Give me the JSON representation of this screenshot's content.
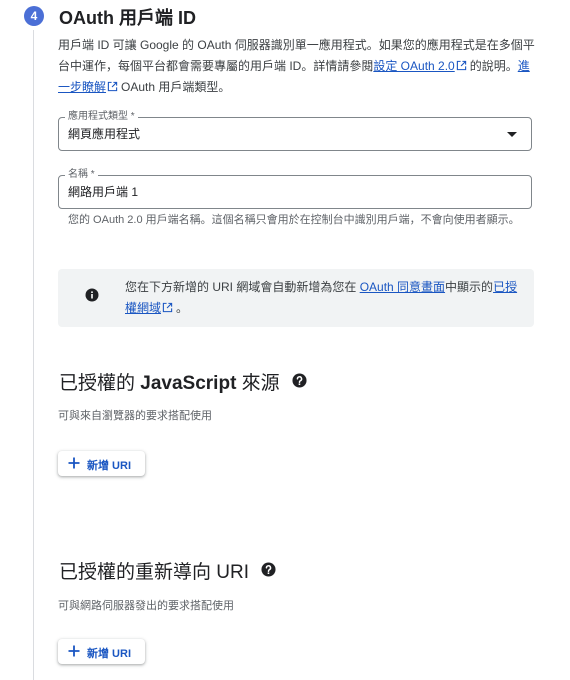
{
  "step": {
    "number": "4",
    "title": "OAuth 用戶端 ID"
  },
  "description": {
    "part1": "用戶端 ID 可讓 Google 的 OAuth 伺服器識別單一應用程式。如果您的應用程式是在多個平台中運作，每個平台都會需要專屬的用戶端 ID。詳情請參閱",
    "link1": "設定 OAuth 2.0",
    "part2": "的說明。",
    "link2": "進一步瞭解",
    "part3": "OAuth 用戶端類型。"
  },
  "app_type_field": {
    "label": "應用程式類型 *",
    "value": "網頁應用程式"
  },
  "name_field": {
    "label": "名稱 *",
    "value": "網路用戶端 1"
  },
  "name_hint": "您的 OAuth 2.0 用戶端名稱。這個名稱只會用於在控制台中識別用戶端，不會向使用者顯示。",
  "info_banner": {
    "part1": "您在下方新增的 URI 網域會自動新增為您在",
    "link1": "OAuth 同意畫面",
    "part2": "中顯示的",
    "link2": "已授權網域",
    "part3": "。"
  },
  "js_origins": {
    "title_part1": "已授權的 ",
    "title_strong": "JavaScript",
    "title_part2": " 來源",
    "subtitle": "可與來自瀏覽器的要求搭配使用",
    "add_button": "新增 URI"
  },
  "redirect_uris": {
    "title": "已授權的重新導向 URI",
    "subtitle": "可與網路伺服器發出的要求搭配使用",
    "add_button": "新增 URI"
  },
  "colors": {
    "accent": "#1a56c2",
    "step_badge": "#4b6fd6",
    "banner_bg": "#f1f3f4"
  },
  "icons": {
    "info": "info-icon",
    "help": "help-icon",
    "external_link": "external-link-icon",
    "dropdown": "dropdown-arrow-icon",
    "add": "plus-icon"
  }
}
